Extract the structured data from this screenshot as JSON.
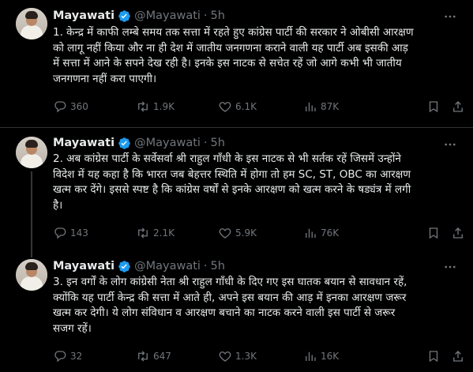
{
  "tweets": [
    {
      "author_name": "Mayawati",
      "handle": "@Mayawati",
      "separator": "·",
      "time": "5h",
      "text": "1. केन्द्र में काफी लम्बे समय तक सत्ता में रहते हुए कांग्रेस पार्टी की सरकार ने ओबीसी आरक्षण\nको लागू नहीं किया और ना ही देश में जातीय जनगणना कराने वाली यह पार्टी अब इसकी आड़\nमें सत्ता में आने के सपने देख रही है। इनके इस नाटक से सचेत रहें जो आगे कभी भी जातीय\nजनगणना नहीं करा पाएगी।",
      "replies": "360",
      "reposts": "1.9K",
      "likes": "6.1K",
      "views": "87K"
    },
    {
      "author_name": "Mayawati",
      "handle": "@Mayawati",
      "separator": "·",
      "time": "5h",
      "text": "2. अब कांग्रेस पार्टी के सर्वेसर्वा श्री राहुल गाँधी के इस नाटक से भी सर्तक रहें जिसमें उन्होंने\nविदेश में यह कहा है कि भारत जब बेहत्तर स्थिति में होगा तो हम SC, ST, OBC का आरक्षण\nखत्म कर देंगे। इससे स्पष्ट है कि कांग्रेस वर्षों से इनके आरक्षण को खत्म करने के षड्यंत्र में लगी\nहै।",
      "replies": "143",
      "reposts": "2.1K",
      "likes": "5.9K",
      "views": "76K"
    },
    {
      "author_name": "Mayawati",
      "handle": "@Mayawati",
      "separator": "·",
      "time": "5h",
      "text": "3. इन वर्गों के लोग कांग्रेसी नेता श्री राहुल गाँधी के दिए गए इस घातक बयान से सावधान रहें,\nक्योंकि यह पार्टी केन्द्र की सत्ता में आते ही, अपने इस बयान की आड़ में इनका आरक्षण जरूर\nखत्म कर देगी। ये लोग संविधान व आरक्षण बचाने का नाटक करने वाली इस पार्टी से जरूर\nसजग रहें।",
      "replies": "32",
      "reposts": "647",
      "likes": "1.3K",
      "views": "16K"
    }
  ],
  "colors": {
    "background": "#000000",
    "text": "#e7e9ea",
    "muted": "#71767b",
    "verified": "#1d9bf0",
    "border": "#2f3336"
  },
  "icons": {
    "verified": "verified-badge-icon",
    "more": "more-horizontal-icon",
    "reply": "reply-icon",
    "repost": "repost-icon",
    "like": "like-icon",
    "views": "views-icon",
    "bookmark": "bookmark-icon",
    "share": "share-icon"
  }
}
